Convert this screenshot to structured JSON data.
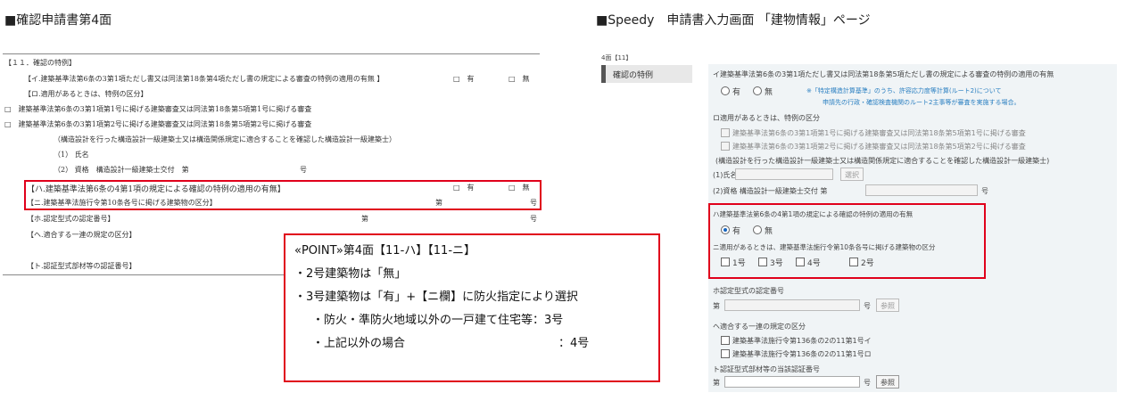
{
  "headers": {
    "left": "■確認申請書第4面",
    "right": "■Speedy　申請書入力画面 「建物情報」ページ"
  },
  "left_form": {
    "title": "【１１．確認の特例】",
    "row_i": "【イ.建築基準法第6条の3第1項ただし書又は同法第18条第4項ただし書の規定による審査の特例の適用の有無 】",
    "row_ro": "【ロ.適用があるときは、特例の区分】",
    "ro_item1": "□　建築基準法第6条の3第1項第1号に掲げる建築審査又は同法第18条第5項第1号に掲げる審査",
    "ro_item2": "□　建築基準法第6条の3第1項第2号に掲げる建築審査又は同法第18条第5項第2号に掲げる審査",
    "ro_note": "（構造設計を行った構造設計一級建築士又は構造関係規定に適合することを確認した構造設計一級建築士）",
    "ro_name": "（1） 氏名",
    "ro_qual": "（2） 資格　構造設計一級建築士交付　第",
    "ro_qual_suffix": "号",
    "row_ha": "【ハ.建築基準法第6条の4第1項の規定による確認の特例の適用の有無】",
    "row_ni": "【ニ.建築基準法施行令第10条各号に掲げる建築物の区分】",
    "row_ni_mid": "第",
    "row_ni_suffix": "号",
    "row_ho": "【ホ.認定型式の認定番号】",
    "row_ho_mid": "第",
    "row_ho_suffix": "号",
    "row_he": "【ヘ.適合する一連の規定の区分】",
    "row_to": "【ト.認証型式部材等の認証番号】",
    "yes": "□　有",
    "no": "□　無"
  },
  "point": {
    "title": "«POINT»第4面【11-ハ】【11-ニ】",
    "line1": "・2号建築物は「無」",
    "line2": "・3号建築物は「有」+【ニ欄】に防火指定により選択",
    "line3": "・防火・準防火地域以外の一戸建て住宅等：3号",
    "line4": "・上記以外の場合",
    "line4_value": "：4号"
  },
  "right_form": {
    "code": "4面【11】",
    "nav_item": "確認の特例",
    "i_label": "イ建築基準法第6条の3第1項ただし書又は同法第18条第5項ただし書の規定による審査の特例の適用の有無",
    "i_yes": "有",
    "i_no": "無",
    "i_note1": "※「特定構造計算基準」のうち、許容応力度等計算(ルート2)について",
    "i_note2": "申請先の行政・確認検査機関のルート2主事等が審査を実施する場合。",
    "ro_label": "ロ適用があるときは、特例の区分",
    "ro_opt1": "建築基準法第6条の3第1項第1号に掲げる建築審査又は同法第18条第5項第1号に掲げる審査",
    "ro_opt2": "建築基準法第6条の3第1項第2号に掲げる建築審査又は同法第18条第5項第2号に掲げる審査",
    "ro_note": "(構造設計を行った構造設計一級建築士又は構造関係規定に適合することを確認した構造設計一級建築士)",
    "name_label": "(1)氏名",
    "select_btn": "選択",
    "qual_label": "(2)資格 構造設計一級建築士交付 第",
    "qual_suffix": "号",
    "ha_label": "ハ建築基準法第6条の4第1項の規定による確認の特例の適用の有無",
    "ha_yes": "有",
    "ha_no": "無",
    "ni_label": "ニ適用があるときは、建築基準法施行令第10条各号に掲げる建築物の区分",
    "ni_opts": [
      "1号",
      "3号",
      "4号",
      "2号"
    ],
    "ho_label": "ホ認定型式の認定番号",
    "ho_prefix": "第",
    "ho_suffix": "号",
    "ho_btn": "参照",
    "he_label": "ヘ適合する一連の規定の区分",
    "he_opt1": "建築基準法施行令第136条の2の11第1号イ",
    "he_opt2": "建築基準法施行令第136条の2の11第1号ロ",
    "to_label": "ト認証型式部材等の当該認証番号",
    "to_prefix": "第",
    "to_suffix": "号",
    "to_btn": "参照"
  }
}
